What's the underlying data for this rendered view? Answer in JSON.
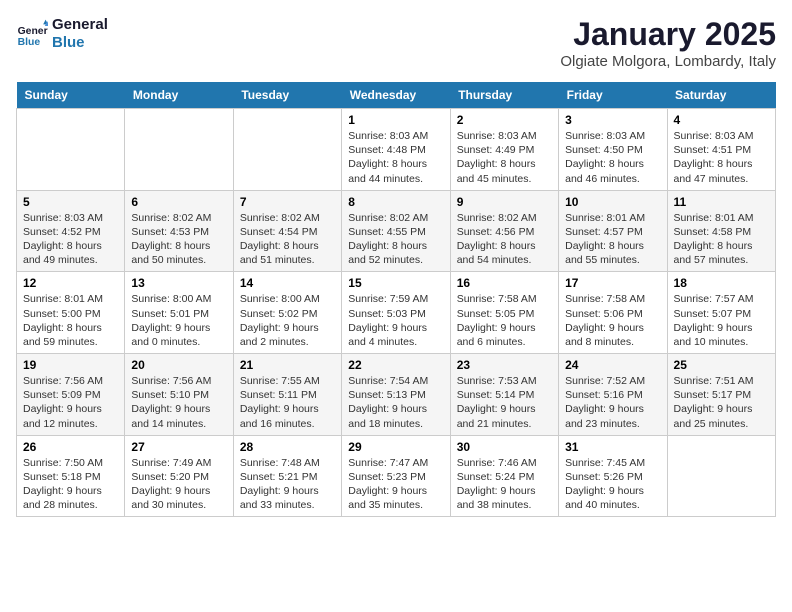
{
  "header": {
    "logo_line1": "General",
    "logo_line2": "Blue",
    "month_title": "January 2025",
    "location": "Olgiate Molgora, Lombardy, Italy"
  },
  "weekdays": [
    "Sunday",
    "Monday",
    "Tuesday",
    "Wednesday",
    "Thursday",
    "Friday",
    "Saturday"
  ],
  "weeks": [
    [
      {
        "day": "",
        "info": ""
      },
      {
        "day": "",
        "info": ""
      },
      {
        "day": "",
        "info": ""
      },
      {
        "day": "1",
        "info": "Sunrise: 8:03 AM\nSunset: 4:48 PM\nDaylight: 8 hours\nand 44 minutes."
      },
      {
        "day": "2",
        "info": "Sunrise: 8:03 AM\nSunset: 4:49 PM\nDaylight: 8 hours\nand 45 minutes."
      },
      {
        "day": "3",
        "info": "Sunrise: 8:03 AM\nSunset: 4:50 PM\nDaylight: 8 hours\nand 46 minutes."
      },
      {
        "day": "4",
        "info": "Sunrise: 8:03 AM\nSunset: 4:51 PM\nDaylight: 8 hours\nand 47 minutes."
      }
    ],
    [
      {
        "day": "5",
        "info": "Sunrise: 8:03 AM\nSunset: 4:52 PM\nDaylight: 8 hours\nand 49 minutes."
      },
      {
        "day": "6",
        "info": "Sunrise: 8:02 AM\nSunset: 4:53 PM\nDaylight: 8 hours\nand 50 minutes."
      },
      {
        "day": "7",
        "info": "Sunrise: 8:02 AM\nSunset: 4:54 PM\nDaylight: 8 hours\nand 51 minutes."
      },
      {
        "day": "8",
        "info": "Sunrise: 8:02 AM\nSunset: 4:55 PM\nDaylight: 8 hours\nand 52 minutes."
      },
      {
        "day": "9",
        "info": "Sunrise: 8:02 AM\nSunset: 4:56 PM\nDaylight: 8 hours\nand 54 minutes."
      },
      {
        "day": "10",
        "info": "Sunrise: 8:01 AM\nSunset: 4:57 PM\nDaylight: 8 hours\nand 55 minutes."
      },
      {
        "day": "11",
        "info": "Sunrise: 8:01 AM\nSunset: 4:58 PM\nDaylight: 8 hours\nand 57 minutes."
      }
    ],
    [
      {
        "day": "12",
        "info": "Sunrise: 8:01 AM\nSunset: 5:00 PM\nDaylight: 8 hours\nand 59 minutes."
      },
      {
        "day": "13",
        "info": "Sunrise: 8:00 AM\nSunset: 5:01 PM\nDaylight: 9 hours\nand 0 minutes."
      },
      {
        "day": "14",
        "info": "Sunrise: 8:00 AM\nSunset: 5:02 PM\nDaylight: 9 hours\nand 2 minutes."
      },
      {
        "day": "15",
        "info": "Sunrise: 7:59 AM\nSunset: 5:03 PM\nDaylight: 9 hours\nand 4 minutes."
      },
      {
        "day": "16",
        "info": "Sunrise: 7:58 AM\nSunset: 5:05 PM\nDaylight: 9 hours\nand 6 minutes."
      },
      {
        "day": "17",
        "info": "Sunrise: 7:58 AM\nSunset: 5:06 PM\nDaylight: 9 hours\nand 8 minutes."
      },
      {
        "day": "18",
        "info": "Sunrise: 7:57 AM\nSunset: 5:07 PM\nDaylight: 9 hours\nand 10 minutes."
      }
    ],
    [
      {
        "day": "19",
        "info": "Sunrise: 7:56 AM\nSunset: 5:09 PM\nDaylight: 9 hours\nand 12 minutes."
      },
      {
        "day": "20",
        "info": "Sunrise: 7:56 AM\nSunset: 5:10 PM\nDaylight: 9 hours\nand 14 minutes."
      },
      {
        "day": "21",
        "info": "Sunrise: 7:55 AM\nSunset: 5:11 PM\nDaylight: 9 hours\nand 16 minutes."
      },
      {
        "day": "22",
        "info": "Sunrise: 7:54 AM\nSunset: 5:13 PM\nDaylight: 9 hours\nand 18 minutes."
      },
      {
        "day": "23",
        "info": "Sunrise: 7:53 AM\nSunset: 5:14 PM\nDaylight: 9 hours\nand 21 minutes."
      },
      {
        "day": "24",
        "info": "Sunrise: 7:52 AM\nSunset: 5:16 PM\nDaylight: 9 hours\nand 23 minutes."
      },
      {
        "day": "25",
        "info": "Sunrise: 7:51 AM\nSunset: 5:17 PM\nDaylight: 9 hours\nand 25 minutes."
      }
    ],
    [
      {
        "day": "26",
        "info": "Sunrise: 7:50 AM\nSunset: 5:18 PM\nDaylight: 9 hours\nand 28 minutes."
      },
      {
        "day": "27",
        "info": "Sunrise: 7:49 AM\nSunset: 5:20 PM\nDaylight: 9 hours\nand 30 minutes."
      },
      {
        "day": "28",
        "info": "Sunrise: 7:48 AM\nSunset: 5:21 PM\nDaylight: 9 hours\nand 33 minutes."
      },
      {
        "day": "29",
        "info": "Sunrise: 7:47 AM\nSunset: 5:23 PM\nDaylight: 9 hours\nand 35 minutes."
      },
      {
        "day": "30",
        "info": "Sunrise: 7:46 AM\nSunset: 5:24 PM\nDaylight: 9 hours\nand 38 minutes."
      },
      {
        "day": "31",
        "info": "Sunrise: 7:45 AM\nSunset: 5:26 PM\nDaylight: 9 hours\nand 40 minutes."
      },
      {
        "day": "",
        "info": ""
      }
    ]
  ]
}
